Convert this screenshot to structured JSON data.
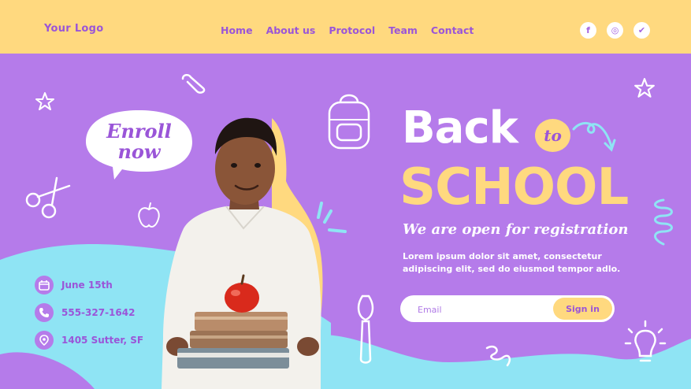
{
  "header": {
    "logo": "Your Logo",
    "nav": [
      "Home",
      "About us",
      "Protocol",
      "Team",
      "Contact"
    ],
    "social": [
      {
        "icon": "facebook-icon",
        "glyph": "f"
      },
      {
        "icon": "instagram-icon",
        "glyph": "◎"
      },
      {
        "icon": "twitter-icon",
        "glyph": "✔"
      }
    ]
  },
  "hero": {
    "title_1": "Back",
    "title_to": "to",
    "title_2": "SCHOOL",
    "subtitle": "We are open for registration",
    "body": "Lorem ipsum dolor sit amet, consectetur adipiscing elit, sed do eiusmod tempor adlo.",
    "email_placeholder": "Email",
    "signin_label": "Sign in"
  },
  "bubble": {
    "line_1": "Enroll",
    "line_2": "now"
  },
  "info": {
    "date": "June 15th",
    "phone": "555-327-1642",
    "address": "1405 Sutter, SF"
  },
  "colors": {
    "purple": "#b57bea",
    "yellow": "#ffd97f",
    "cyan": "#8fe4f4",
    "text_purple": "#9a55d8"
  }
}
